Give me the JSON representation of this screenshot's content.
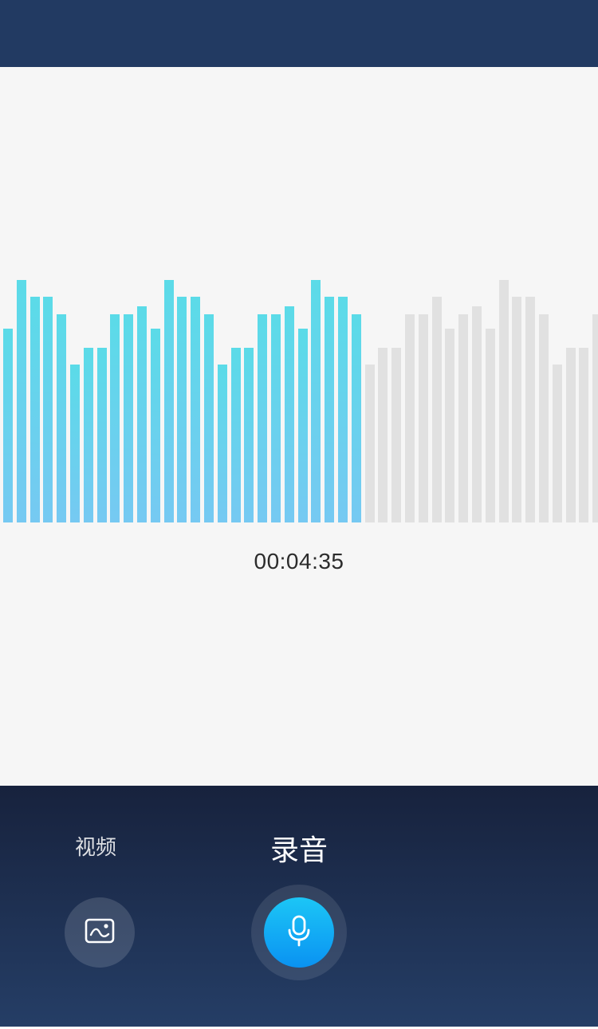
{
  "recorder": {
    "timer": "00:04:35",
    "waveform": {
      "levels": [
        0.8,
        1.0,
        0.93,
        0.93,
        0.86,
        0.65,
        0.72,
        0.72,
        0.86,
        0.86,
        0.89,
        0.8,
        1.0,
        0.93,
        0.93,
        0.86,
        0.65,
        0.72,
        0.72,
        0.86,
        0.86,
        0.89,
        0.8,
        1.0,
        0.93,
        0.93,
        0.86,
        0.65,
        0.72,
        0.72,
        0.86,
        0.86,
        0.93,
        0.8,
        0.86,
        0.89,
        0.8,
        1.0,
        0.93,
        0.93,
        0.86,
        0.65,
        0.72,
        0.72,
        0.86
      ],
      "played_count": 27,
      "played_color": "#5bdbe8",
      "remaining_color": "#e1e1e1"
    }
  },
  "modes": {
    "video_label": "视频",
    "audio_label": "录音"
  },
  "controls": {
    "gallery_icon": "image-icon",
    "record_icon": "microphone-icon",
    "accent_color": "#0a92f2"
  },
  "theme": {
    "header_color": "#223a62",
    "panel_color": "#17223d"
  }
}
